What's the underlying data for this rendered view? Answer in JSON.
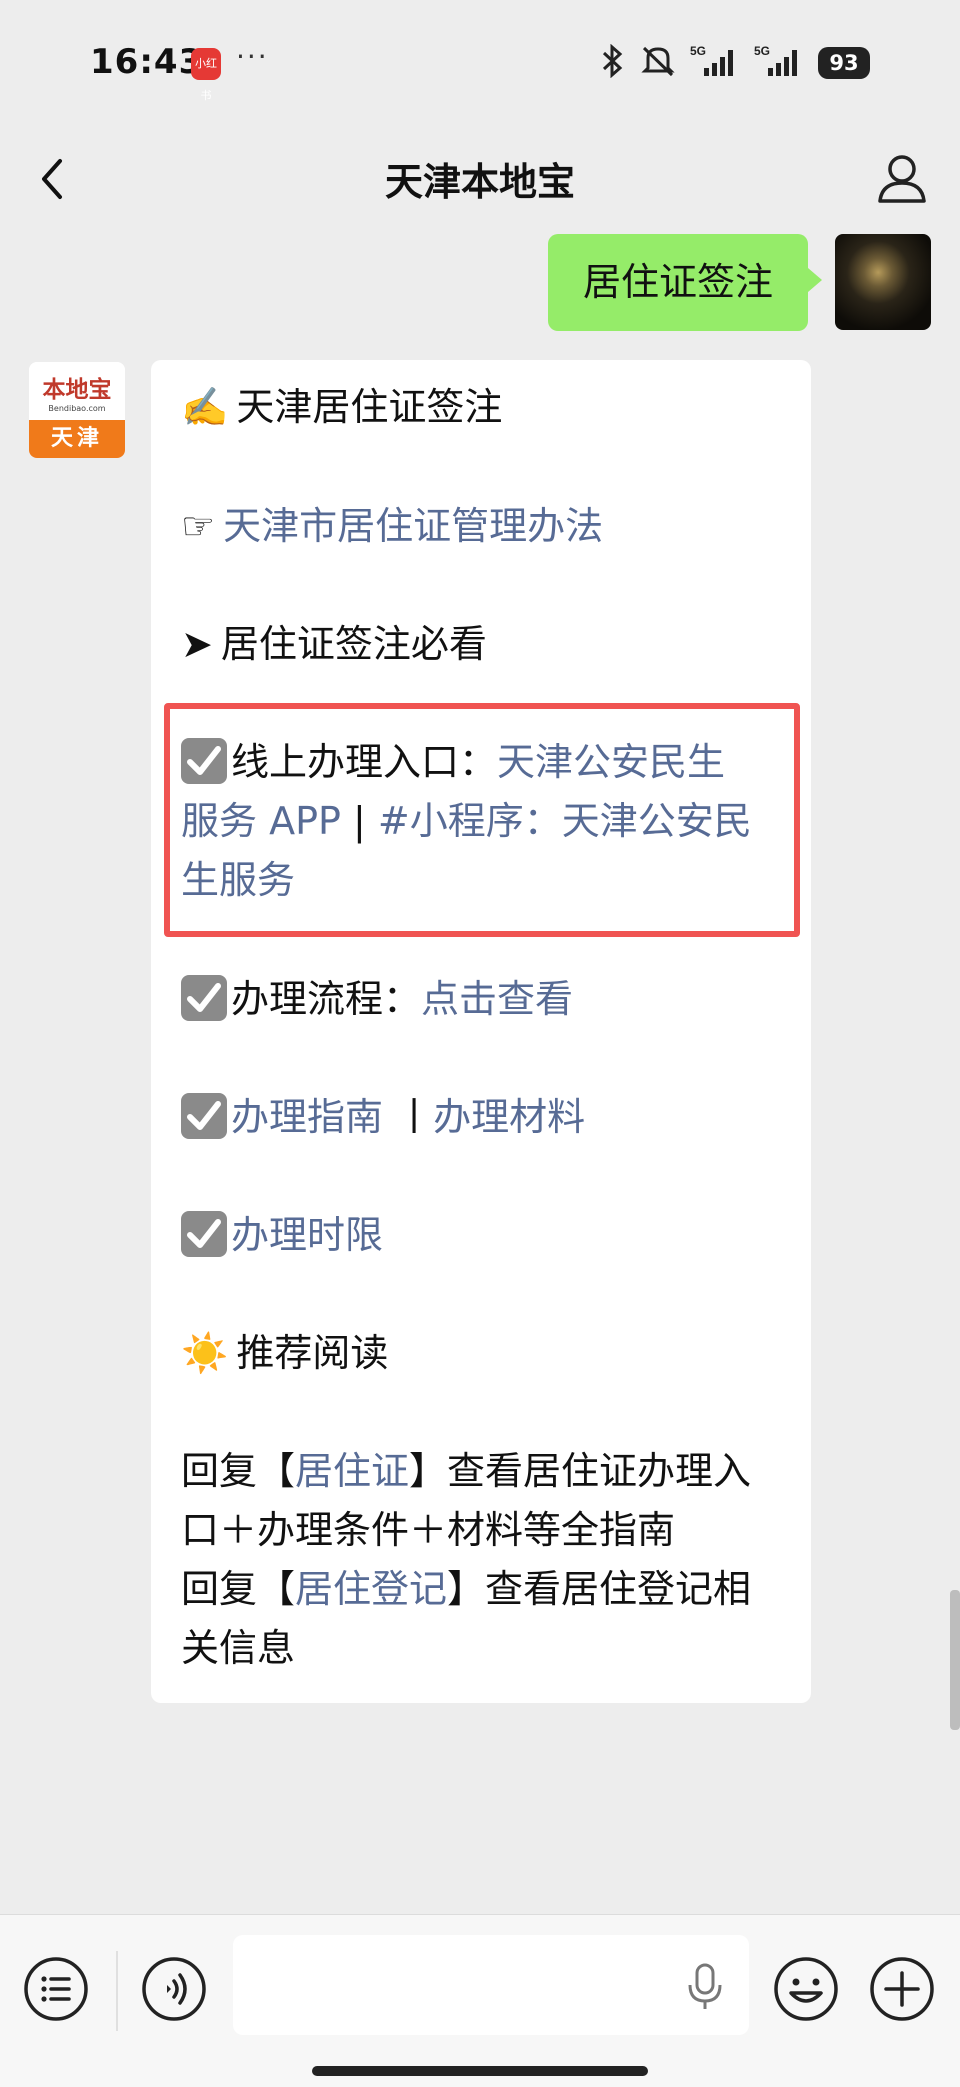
{
  "status": {
    "time": "16:43",
    "app_badge": "小红书",
    "more": "···",
    "network1": "5G",
    "network2": "5G",
    "battery": "93"
  },
  "nav": {
    "title": "天津本地宝"
  },
  "my_message": {
    "text": "居住证签注"
  },
  "bot_avatar": {
    "logo": "本地宝",
    "url": "Bendibao.com",
    "city": "天津"
  },
  "bot_message": {
    "title_emoji": "✍️",
    "title": "天津居住证签注",
    "point_symbol": "☞",
    "rules_link": "天津市居住证管理办法",
    "arrow_symbol": "➤",
    "must_read": "居住证签注必看",
    "online": {
      "label": "线上办理入口：",
      "app_link_part1": "天津公安民生",
      "app_link_part2": "服务 APP",
      "separator": " | ",
      "mini_link_part1": "#小程序：天津公安民",
      "mini_link_part2": "生服务"
    },
    "process": {
      "label": "办理流程：",
      "link": "点击查看"
    },
    "guide_link": "办理指南",
    "guide_separator": " 丨",
    "materials_link": "办理材料",
    "timelimit_link": "办理时限",
    "recommend_emoji": "☀️",
    "recommend": "推荐阅读",
    "reply1": {
      "prefix": "回复【",
      "keyword": "居住证",
      "suffix_line1": "】查看居住证办理入",
      "line2": "口＋办理条件＋材料等全指南"
    },
    "reply2": {
      "prefix": "回复【",
      "keyword": "居住登记",
      "suffix_line1": "】查看居住登记相",
      "line2": "关信息"
    }
  },
  "colors": {
    "link": "#576b95",
    "my_bubble": "#95ec69",
    "highlight_border": "#f05452",
    "background": "#ededed"
  },
  "icons": [
    "back-arrow-icon",
    "profile-icon",
    "menu-list-icon",
    "voice-icon",
    "mic-icon",
    "emoji-icon",
    "plus-icon",
    "bluetooth-icon",
    "mute-icon",
    "signal-icon"
  ]
}
